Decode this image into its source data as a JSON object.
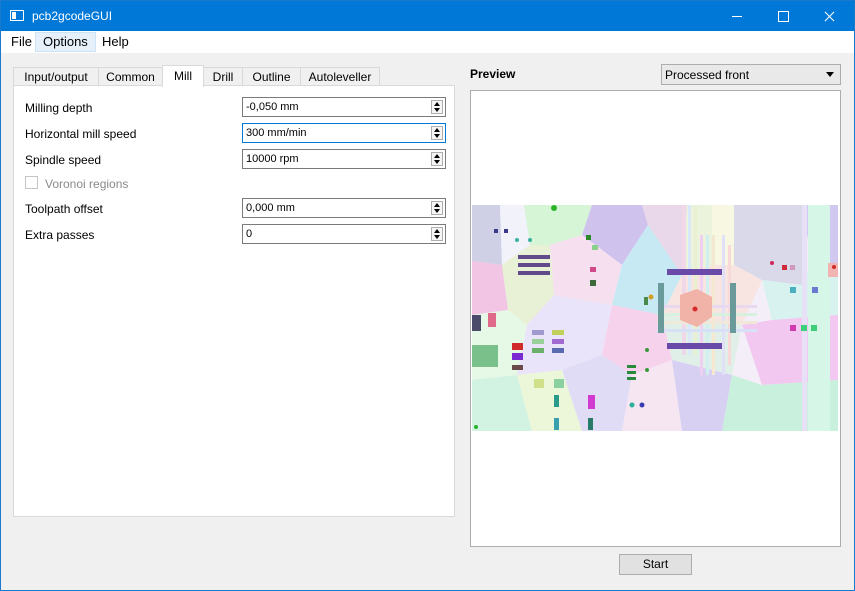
{
  "window": {
    "title": "pcb2gcodeGUI"
  },
  "menu": {
    "file": "File",
    "options": "Options",
    "help": "Help"
  },
  "tabs": {
    "io": "Input/output",
    "common": "Common",
    "mill": "Mill",
    "drill": "Drill",
    "outline": "Outline",
    "autoleveller": "Autoleveller"
  },
  "mill": {
    "milling_depth_label": "Milling depth",
    "milling_depth_value": "-0,050 mm",
    "horizontal_speed_label": "Horizontal mill speed",
    "horizontal_speed_value": "300 mm/min",
    "spindle_speed_label": "Spindle speed",
    "spindle_speed_value": "10000 rpm",
    "voronoi_label": "Voronoi regions",
    "toolpath_offset_label": "Toolpath offset",
    "toolpath_offset_value": "0,000 mm",
    "extra_passes_label": "Extra passes",
    "extra_passes_value": "0"
  },
  "preview": {
    "label": "Preview",
    "selected_view": "Processed front"
  },
  "actions": {
    "start": "Start"
  },
  "icons": [
    "app-icon",
    "minimize-icon",
    "maximize-icon",
    "close-icon",
    "spin-up-icon",
    "spin-down-icon",
    "dropdown-arrow-icon"
  ]
}
